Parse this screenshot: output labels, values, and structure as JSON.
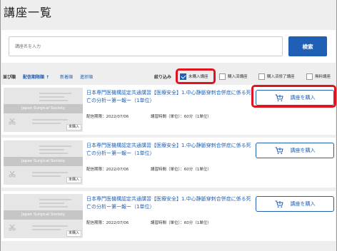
{
  "page": {
    "title": "講座一覧"
  },
  "search": {
    "placeholder": "講座名を入力",
    "button_label": "検索"
  },
  "sort": {
    "label": "並び順",
    "options": [
      {
        "label": "配信期限順 ↑",
        "active": true
      },
      {
        "label": "新着順",
        "active": false
      },
      {
        "label": "進捗順",
        "active": false
      }
    ]
  },
  "filter": {
    "label": "絞り込み",
    "options": [
      {
        "label": "未購入講座",
        "checked": true
      },
      {
        "label": "購入済講座",
        "checked": false
      },
      {
        "label": "購入済修了講座",
        "checked": false
      },
      {
        "label": "無料講座",
        "checked": false
      }
    ]
  },
  "courses": [
    {
      "title": "日本専門医機構認定共通講習【医療安全】1.中心静脈穿刺合併症に係る死亡の分析ー第一報ー（1単位）",
      "deadline": "配信期限：2022/07/06",
      "duration": "講習時間（単位）：60分（1単位）",
      "button_label": "講座を購入",
      "thumb_label": "Japan Surgical Society",
      "status_badge": "未購入"
    },
    {
      "title": "日本専門医機構認定共通講習【医療安全】1.中心静脈穿刺合併症に係る死亡の分析ー第一報ー（1単位）",
      "deadline": "配信期限：2022/07/06",
      "duration": "講習時間（単位）：60分（1単位）",
      "button_label": "講座を購入",
      "thumb_label": "Japan Surgical Society",
      "status_badge": "未購入"
    },
    {
      "title": "日本専門医機構認定共通講習【医療安全】1.中心静脈穿刺合併症に係る死亡の分析ー第一報ー（1単位）",
      "deadline": "配信期限：2022/07/06",
      "duration": "講習時間（単位）：60分（1単位）",
      "button_label": "講座を購入",
      "thumb_label": "Japan Surgical Society",
      "status_badge": "未購入"
    }
  ],
  "colors": {
    "accent": "#1f5fb5",
    "highlight": "#e0141e",
    "background": "#eeeeee"
  },
  "icons": {
    "buy": "cart-icon",
    "thumb": "scissors-icon"
  }
}
